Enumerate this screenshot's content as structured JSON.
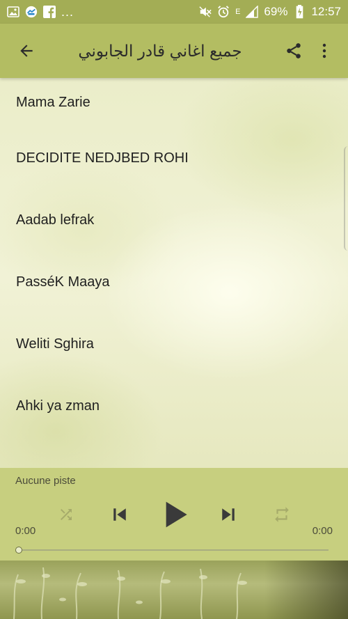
{
  "status_bar": {
    "battery_percent": "69%",
    "time": "12:57",
    "network_letter": "E",
    "overflow": "...",
    "left_icons": [
      "image-icon",
      "messenger-app-icon",
      "facebook-icon"
    ],
    "right_icons": [
      "mute-icon",
      "alarm-icon",
      "signal-icon",
      "battery-icon"
    ]
  },
  "toolbar": {
    "title": "جميع اغاني قادر الجابوني",
    "icons": [
      "back-arrow-icon",
      "share-icon",
      "more-vert-icon"
    ]
  },
  "songs": [
    "Mama Zarie",
    "DECIDITE NEDJBED ROHI",
    "Aadab lefrak",
    "PasséK Maaya",
    "Weliti Sghira",
    "Ahki ya zman"
  ],
  "player": {
    "track_name": "Aucune piste",
    "time_elapsed": "0:00",
    "time_total": "0:00",
    "progress": 0,
    "controls": [
      "shuffle-icon",
      "previous-icon",
      "play-icon",
      "next-icon",
      "repeat-icon"
    ]
  },
  "colors": {
    "status_bar": "#a3ad55",
    "toolbar": "#b3bd62",
    "player": "#c7cf7f",
    "control_active": "#3a3a3a",
    "control_disabled": "#a6ab6a"
  }
}
